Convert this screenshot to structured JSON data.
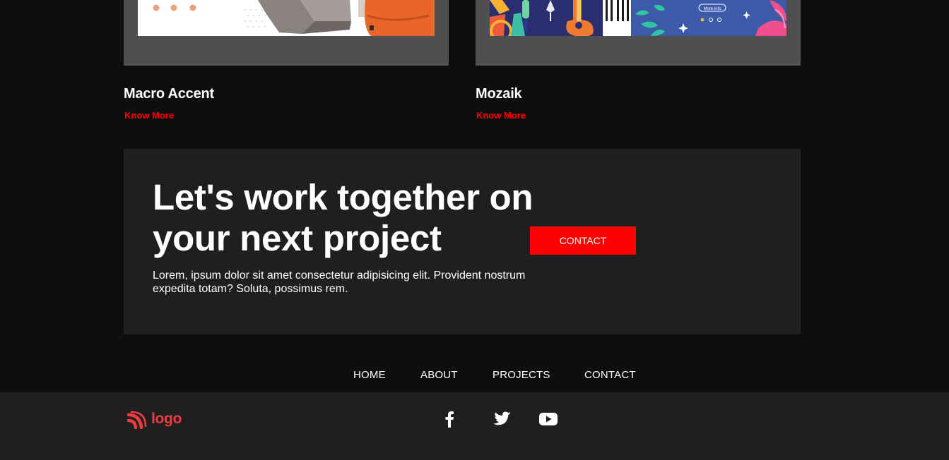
{
  "projects": [
    {
      "title": "Macro Accent",
      "link": "Know More"
    },
    {
      "title": "Mozaik",
      "link": "Know More"
    }
  ],
  "thumb_mozaik": {
    "badge": "More info"
  },
  "cta": {
    "heading_line1": "Let's work together on",
    "heading_line2": "your next project",
    "text": "Lorem, ipsum dolor sit amet consectetur adipisicing elit. Provident nostrum expedita totam? Soluta, possimus rem.",
    "button": "CONTACT"
  },
  "nav": [
    "HOME",
    "ABOUT",
    "PROJECTS",
    "CONTACT"
  ],
  "footer": {
    "logo_text": "logo",
    "social": [
      "facebook-icon",
      "twitter-icon",
      "youtube-icon"
    ]
  },
  "colors": {
    "accent": "#ff0000",
    "logo": "#ef3b42",
    "panel": "#1f1f1f",
    "page_bg": "#0e0e0e",
    "card_bg": "#4f4f4f"
  }
}
